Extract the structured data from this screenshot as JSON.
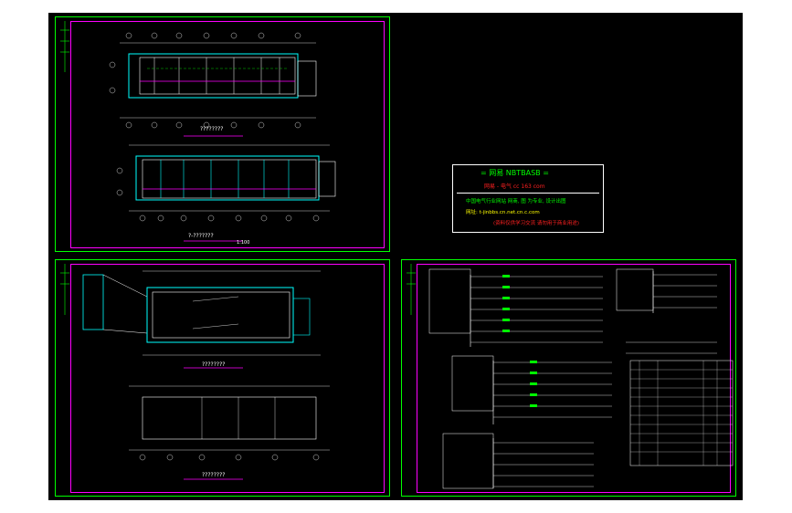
{
  "drawing": {
    "sheets": [
      {
        "id": "sheet-top-left",
        "captions": [
          "????????",
          "?-???????"
        ],
        "scale": "1:100"
      },
      {
        "id": "sheet-bottom-left",
        "captions": [
          "????????",
          "????????"
        ]
      },
      {
        "id": "sheet-top-right",
        "title_block": {
          "line1": "= 网易  NBTBASB =",
          "line2": "网易 - 电气    cc 163 com",
          "line3": "中国电气行业网站 网商, 图 为专业, 设计出图",
          "line4": "网址: t-jinbbs.cn.net.cn.c.com",
          "line5": "(资料仅供学习交流 请勿用于商业用途)"
        }
      },
      {
        "id": "sheet-bottom-right",
        "label": "system diagram"
      }
    ]
  },
  "colors": {
    "background": "#000000",
    "frame": "#00ff00",
    "border": "#ff00ff",
    "wall": "#00ffff",
    "text": "#ffffff",
    "accent_red": "#ff2020",
    "accent_yellow": "#ffff00"
  }
}
